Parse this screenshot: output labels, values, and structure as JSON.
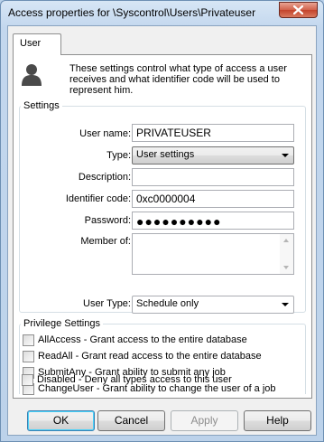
{
  "window": {
    "title": "Access properties for \\Syscontrol\\Users\\Privateuser"
  },
  "tabs": [
    {
      "label": "User"
    }
  ],
  "info": {
    "text": "These settings control what type of access a user receives and what identifier code will be used to represent him."
  },
  "settings": {
    "group_label": "Settings",
    "user_name_label": "User name:",
    "user_name_value": "PRIVATEUSER",
    "type_label": "Type:",
    "type_value": "User settings",
    "description_label": "Description:",
    "description_value": "",
    "identifier_label": "Identifier code:",
    "identifier_value": "0xc0000004",
    "password_label": "Password:",
    "password_value": "●●●●●●●●●●",
    "member_of_label": "Member of:",
    "user_type_label": "User Type:",
    "user_type_value": "Schedule only"
  },
  "privileges": {
    "group_label": "Privilege Settings",
    "items": [
      {
        "label": "AllAccess - Grant access to the entire database",
        "checked": false
      },
      {
        "label": "ReadAll - Grant read access to the entire database",
        "checked": false
      },
      {
        "label": "SubmitAny - Grant ability to submit any job",
        "checked": false
      },
      {
        "label": "ChangeUser - Grant ability to change the user of a job",
        "checked": false
      },
      {
        "label": "Disabled - Deny all types access to this user",
        "checked": false
      }
    ]
  },
  "buttons": {
    "ok": "OK",
    "cancel": "Cancel",
    "apply": "Apply",
    "help": "Help"
  }
}
